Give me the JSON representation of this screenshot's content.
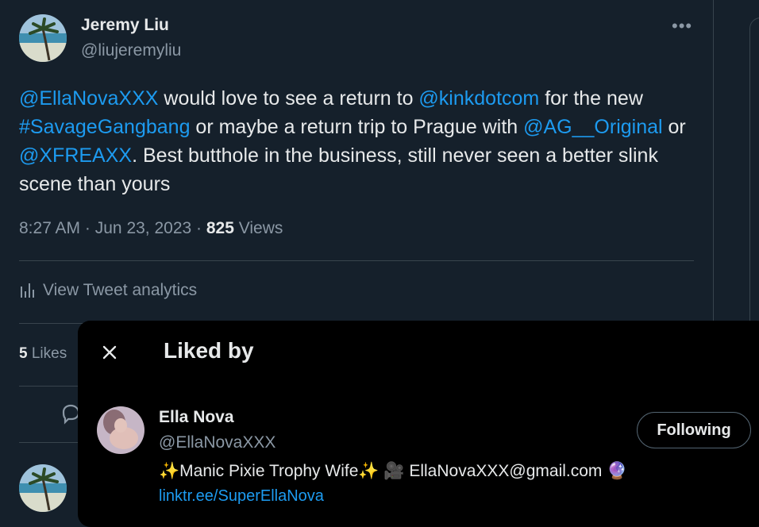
{
  "tweet": {
    "author": {
      "name": "Jeremy Liu",
      "handle": "@liujeremyliu"
    },
    "more_icon": "more-horizontal-icon",
    "text_segments": [
      {
        "text": "@EllaNovaXXX",
        "link": true
      },
      {
        "text": " would love to see a return to ",
        "link": false
      },
      {
        "text": "@kinkdotcom",
        "link": true
      },
      {
        "text": " for the new ",
        "link": false
      },
      {
        "text": "#SavageGangbang",
        "link": true
      },
      {
        "text": " or maybe a return trip to Prague with ",
        "link": false
      },
      {
        "text": "@AG__Original",
        "link": true
      },
      {
        "text": " or ",
        "link": false
      },
      {
        "text": "@XFREAXX",
        "link": true
      },
      {
        "text": ". Best butthole in the business, still never seen a better slink scene than yours",
        "link": false
      }
    ],
    "time": "8:27 AM",
    "date": "Jun 23, 2023",
    "separator": "·",
    "views_count": "825",
    "views_label": "Views",
    "analytics_label": "View Tweet analytics",
    "likes_count": "5",
    "likes_label": "Likes"
  },
  "modal": {
    "title": "Liked by",
    "close_icon": "close-icon",
    "users": [
      {
        "name": "Ella Nova",
        "handle": "@EllaNovaXXX",
        "button_label": "Following",
        "bio": "✨Manic Pixie Trophy Wife✨ 🎥 EllaNovaXXX@gmail.com 🔮",
        "link": "linktr.ee/SuperEllaNova"
      }
    ]
  },
  "colors": {
    "background": "#15202b",
    "modal_background": "#000000",
    "link": "#1d9bf0",
    "secondary_text": "#8b98a5",
    "border": "#38444d"
  }
}
